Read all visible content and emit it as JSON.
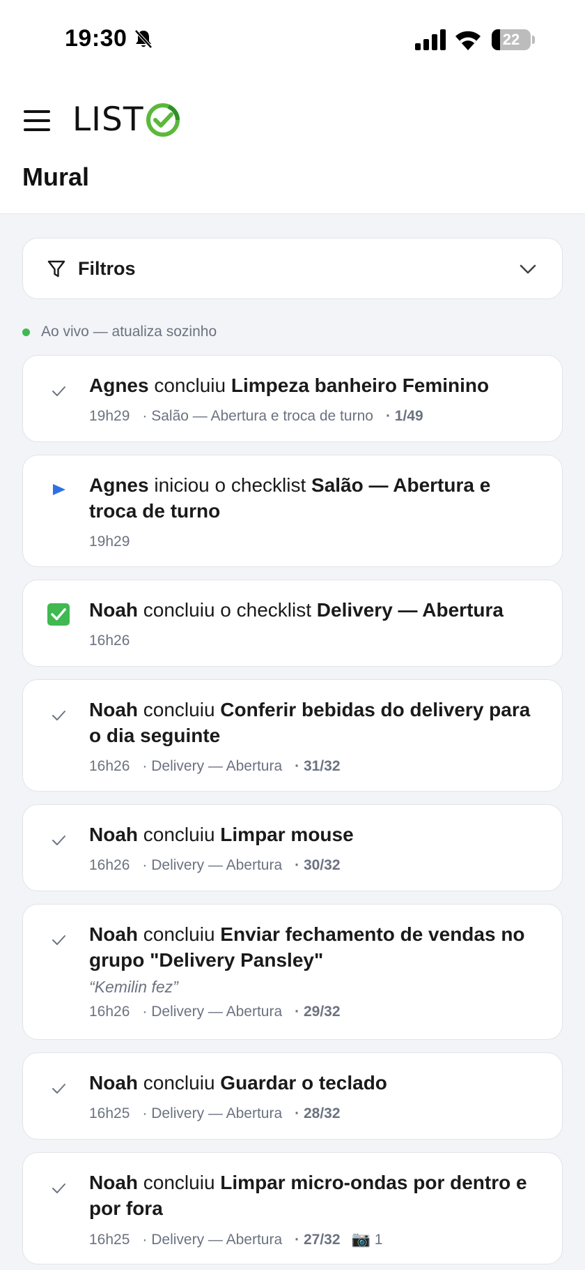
{
  "status_bar": {
    "time": "19:30",
    "battery": "22"
  },
  "header": {
    "logo_text": "LIST",
    "page_title": "Mural"
  },
  "filter": {
    "label": "Filtros"
  },
  "live": {
    "text": "Ao vivo — atualiza sozinho"
  },
  "colors": {
    "accent_green": "#3fb950",
    "start_blue": "#2f6fe4",
    "text_gray": "#6b7280"
  },
  "feed": [
    {
      "icon": "check-icon",
      "user": "Agnes",
      "verb": "concluiu",
      "task": "Limpeza banheiro Feminino",
      "time": "19h29",
      "checklist": "Salão — Abertura e troca de turno",
      "progress": "1/49"
    },
    {
      "icon": "play-icon",
      "user": "Agnes",
      "verb": "iniciou o checklist",
      "task": "Salão — Abertura e troca de turno",
      "time": "19h29"
    },
    {
      "icon": "check-box-icon",
      "user": "Noah",
      "verb": "concluiu o checklist",
      "task": "Delivery — Abertura",
      "time": "16h26"
    },
    {
      "icon": "check-icon",
      "user": "Noah",
      "verb": "concluiu",
      "task": "Conferir bebidas do delivery para o dia seguinte",
      "time": "16h26",
      "checklist": "Delivery — Abertura",
      "progress": "31/32"
    },
    {
      "icon": "check-icon",
      "user": "Noah",
      "verb": "concluiu",
      "task": "Limpar mouse",
      "time": "16h26",
      "checklist": "Delivery — Abertura",
      "progress": "30/32"
    },
    {
      "icon": "check-icon",
      "user": "Noah",
      "verb": "concluiu",
      "task": "Enviar fechamento de vendas no grupo \"Delivery Pansley\"",
      "note": "“Kemilin fez”",
      "time": "16h26",
      "checklist": "Delivery — Abertura",
      "progress": "29/32"
    },
    {
      "icon": "check-icon",
      "user": "Noah",
      "verb": "concluiu",
      "task": "Guardar o teclado",
      "time": "16h25",
      "checklist": "Delivery — Abertura",
      "progress": "28/32"
    },
    {
      "icon": "check-icon",
      "user": "Noah",
      "verb": "concluiu",
      "task": "Limpar micro-ondas por dentro e por fora",
      "time": "16h25",
      "checklist": "Delivery — Abertura",
      "progress": "27/32",
      "photos": "1"
    }
  ]
}
